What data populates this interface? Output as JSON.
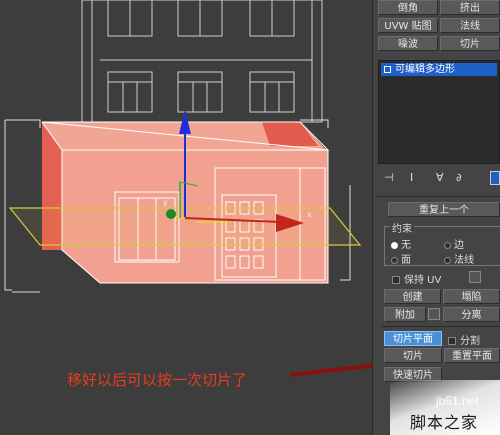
{
  "toolbar_buttons": {
    "bevel": "倒角",
    "extrude": "挤出",
    "uvw_map": "UVW 贴图",
    "normal": "法线",
    "noise": "噪波",
    "slice": "切片"
  },
  "modifier_stack": {
    "items": [
      "可编辑多边形"
    ]
  },
  "rollout": {
    "title": "重复上一个",
    "constraints_label": "约束",
    "constraint_none": "无",
    "constraint_edge": "边",
    "constraint_face": "面",
    "constraint_normal": "法线",
    "selected_constraint": "无",
    "preserve_uv": "保持 UV",
    "create": "创建",
    "collapse": "塌陷",
    "attach": "附加",
    "detach": "分离",
    "slice_plane": "切片平面",
    "split": "分割",
    "slice": "切片",
    "reset_plane": "重置平面",
    "quickslice": "快速切片"
  },
  "annotation": "移好以后可以按一次切片了",
  "gizmo": {
    "y_axis": "y",
    "x_axis": "x"
  },
  "watermark": {
    "site": "jb51.net",
    "name": "脚本之家"
  },
  "colors": {
    "viewport_bg": "#3d3d3d",
    "building_fill": "#f2a090",
    "building_side": "#e06a5a",
    "wireframe": "#ffffff",
    "gizmo_y": "#1f2fd8",
    "gizmo_x": "#c0261a",
    "slice_plane": "#d8c83a",
    "selection_blue": "#1f5fc9",
    "annotation": "#e83c1e"
  }
}
